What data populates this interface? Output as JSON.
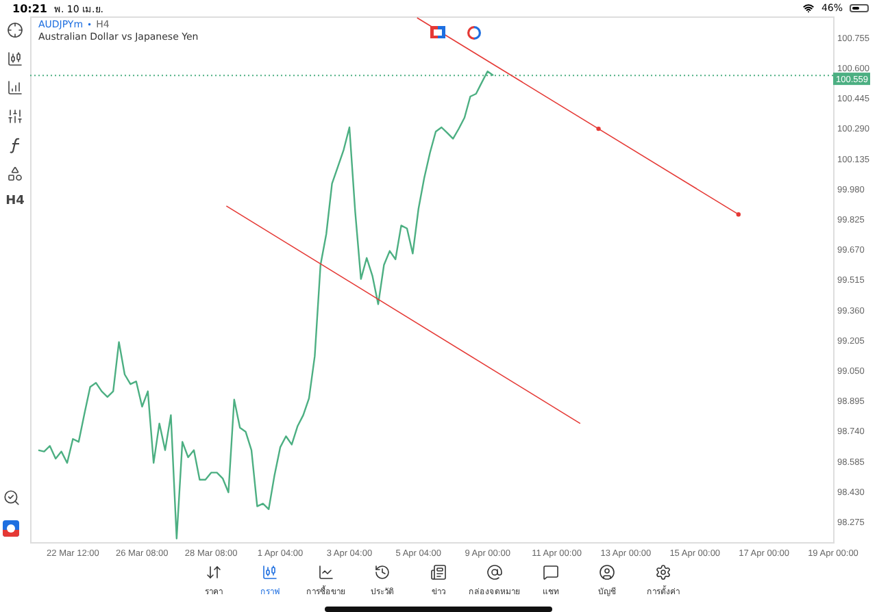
{
  "status_bar": {
    "time": "10:21",
    "date": "พ. 10 เม.ย.",
    "battery": "46%"
  },
  "left_tools": [
    {
      "kind": "crosshair"
    },
    {
      "kind": "candles"
    },
    {
      "kind": "indicators"
    },
    {
      "kind": "sliders"
    },
    {
      "kind": "function"
    },
    {
      "kind": "shapes"
    },
    {
      "kind": "text",
      "label": "H4"
    }
  ],
  "price_tag": "100.559",
  "legend": {
    "symbol": "AUDJPYm",
    "separator": "•",
    "timeframe": "H4",
    "description": "Australian Dollar vs Japanese Yen"
  },
  "chart_data": {
    "type": "line",
    "categories": [
      null,
      null,
      null,
      null,
      null,
      null,
      "22 Mar 12:00",
      null,
      null,
      null,
      null,
      null,
      null,
      null,
      null,
      null,
      null,
      null,
      "26 Mar 08:00",
      null,
      null,
      null,
      null,
      null,
      null,
      null,
      null,
      null,
      null,
      null,
      "28 Mar 08:00",
      null,
      null,
      null,
      null,
      null,
      null,
      null,
      null,
      null,
      null,
      null,
      "1 Apr 04:00",
      null,
      null,
      null,
      null,
      null,
      null,
      null,
      null,
      null,
      null,
      null,
      "3 Apr 04:00",
      null,
      null,
      null,
      null,
      null,
      null,
      null,
      null,
      null,
      null,
      null,
      "5 Apr 04:00",
      null,
      null,
      null,
      null,
      null,
      null,
      null,
      null,
      null,
      null,
      null,
      "9 Apr 00:00",
      null,
      null,
      null,
      null,
      null,
      null,
      null,
      null,
      null,
      null,
      null,
      "11 Apr 00:00",
      null,
      null,
      null,
      null,
      null,
      null,
      null,
      null,
      null,
      null,
      null,
      "13 Apr 00:00",
      null,
      null,
      null,
      null,
      null,
      null,
      null,
      null,
      null,
      null,
      null,
      "15 Apr 00:00",
      null,
      null,
      null,
      null,
      null,
      null,
      null,
      null,
      null,
      null,
      null,
      "17 Apr 00:00",
      null,
      null,
      null,
      null,
      null,
      null,
      null,
      null,
      null,
      null,
      null,
      "19 Apr 00:00"
    ],
    "series": [
      {
        "color": "#4caf82",
        "values": [
          98.641,
          98.634,
          98.663,
          98.598,
          98.634,
          98.576,
          98.699,
          98.684,
          98.828,
          98.965,
          98.986,
          98.943,
          98.914,
          98.943,
          99.195,
          99.029,
          98.979,
          98.993,
          98.864,
          98.943,
          98.576,
          98.778,
          98.641,
          98.821,
          98.188,
          98.684,
          98.605,
          98.641,
          98.49,
          98.49,
          98.526,
          98.526,
          98.497,
          98.425,
          98.9,
          98.756,
          98.735,
          98.641,
          98.354,
          98.368,
          98.339,
          98.512,
          98.656,
          98.713,
          98.67,
          98.763,
          98.821,
          98.907,
          99.123,
          99.59,
          99.748,
          100.007,
          100.094,
          100.18,
          100.295,
          99.863,
          99.518,
          99.626,
          99.533,
          99.389,
          99.59,
          99.662,
          99.619,
          99.792,
          99.777,
          99.648,
          99.878,
          100.036,
          100.165,
          100.273,
          100.295,
          100.266,
          100.237,
          100.288,
          100.345,
          100.453,
          100.467,
          100.525,
          100.582,
          100.561,
          null,
          null,
          null,
          null,
          null,
          null,
          null,
          null,
          null,
          null,
          null,
          null,
          null,
          null,
          null,
          null,
          null,
          null,
          null,
          null,
          null,
          null,
          null,
          null,
          null,
          null,
          null,
          null,
          null,
          null,
          null,
          null,
          null,
          null,
          null,
          null,
          null,
          null,
          null,
          null,
          null,
          null,
          null,
          null,
          null,
          null,
          null,
          null,
          null,
          null,
          null,
          null,
          null,
          null,
          null,
          null,
          null,
          null,
          null
        ]
      }
    ],
    "ylim": [
      98.17,
      100.863
    ],
    "yticks": [
      {
        "value": 100.755,
        "label": "100.755"
      },
      {
        "value": 100.6,
        "label": "100.600"
      },
      {
        "value": 100.445,
        "label": "100.445"
      },
      {
        "value": 100.29,
        "label": "100.290"
      },
      {
        "value": 100.135,
        "label": "100.135"
      },
      {
        "value": 99.98,
        "label": "99.980"
      },
      {
        "value": 99.825,
        "label": "99.825"
      },
      {
        "value": 99.67,
        "label": "99.670"
      },
      {
        "value": 99.515,
        "label": "99.515"
      },
      {
        "value": 99.36,
        "label": "99.360"
      },
      {
        "value": 99.205,
        "label": "99.205"
      },
      {
        "value": 99.05,
        "label": "99.050"
      },
      {
        "value": 98.895,
        "label": "98.895"
      },
      {
        "value": 98.74,
        "label": "98.740"
      },
      {
        "value": 98.585,
        "label": "98.585"
      },
      {
        "value": 98.43,
        "label": "98.430"
      },
      {
        "value": 98.275,
        "label": "98.275"
      }
    ]
  },
  "tabs": [
    {
      "label": "ราคา",
      "selected": false
    },
    {
      "label": "กราฟ",
      "selected": true
    },
    {
      "label": "การซื้อขาย",
      "selected": false
    },
    {
      "label": "ประวัติ",
      "selected": false
    },
    {
      "label": "ข่าว",
      "selected": false
    },
    {
      "label": "กล่องจดหมาย",
      "selected": false
    },
    {
      "label": "แชท",
      "selected": false
    },
    {
      "label": "บัญชี",
      "selected": false
    },
    {
      "label": "การตั้งค่า",
      "selected": false
    }
  ]
}
